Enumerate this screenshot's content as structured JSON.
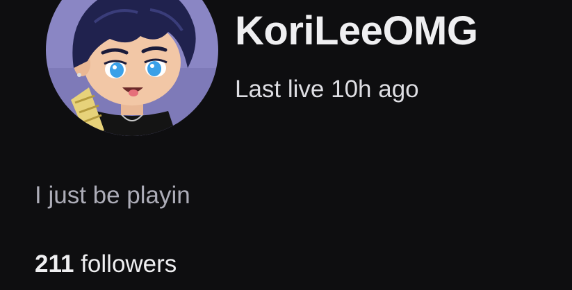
{
  "channel": {
    "name": "KoriLeeOMG",
    "last_live": "Last live 10h ago",
    "bio": "I just be playin",
    "followers_count": "211",
    "followers_label": "followers"
  },
  "avatar": {
    "icon": "channel-avatar-illustration",
    "background_color": "#8a86c4",
    "hair_color": "#20224e",
    "skin_color": "#f2c7a6",
    "eye_color": "#3aa0e8"
  },
  "colors": {
    "page_background": "#0e0e10",
    "primary_text": "#efeff1",
    "secondary_text": "#adadb8"
  }
}
